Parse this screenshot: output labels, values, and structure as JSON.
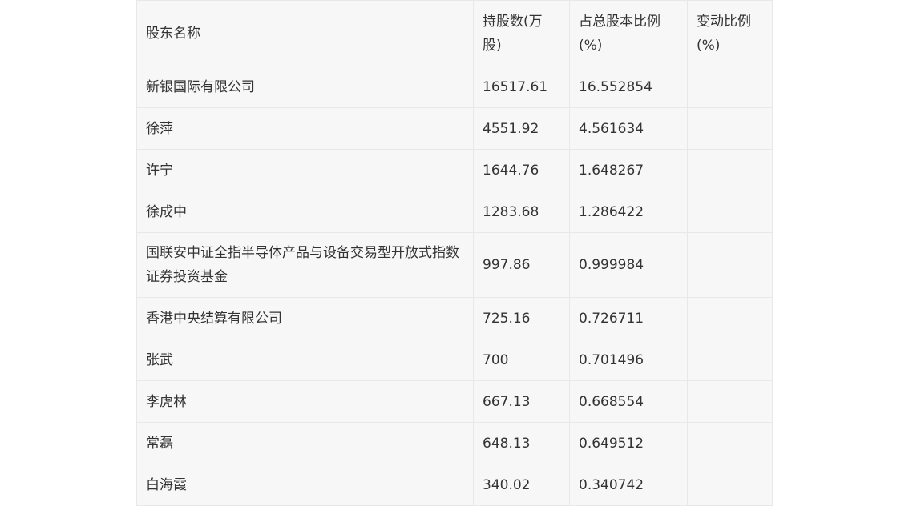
{
  "table": {
    "headers": [
      "股东名称",
      "持股数(万股)",
      "占总股本比例(%)",
      "变动比例(%)"
    ],
    "rows": [
      {
        "name": "新银国际有限公司",
        "shares": "16517.61",
        "ratio": "16.552854",
        "change": ""
      },
      {
        "name": "徐萍",
        "shares": "4551.92",
        "ratio": "4.561634",
        "change": ""
      },
      {
        "name": "许宁",
        "shares": "1644.76",
        "ratio": "1.648267",
        "change": ""
      },
      {
        "name": "徐成中",
        "shares": "1283.68",
        "ratio": "1.286422",
        "change": ""
      },
      {
        "name": "国联安中证全指半导体产品与设备交易型开放式指数证券投资基金",
        "shares": "997.86",
        "ratio": "0.999984",
        "change": ""
      },
      {
        "name": "香港中央结算有限公司",
        "shares": "725.16",
        "ratio": "0.726711",
        "change": ""
      },
      {
        "name": "张武",
        "shares": "700",
        "ratio": "0.701496",
        "change": ""
      },
      {
        "name": "李虎林",
        "shares": "667.13",
        "ratio": "0.668554",
        "change": ""
      },
      {
        "name": "常磊",
        "shares": "648.13",
        "ratio": "0.649512",
        "change": ""
      },
      {
        "name": "白海霞",
        "shares": "340.02",
        "ratio": "0.340742",
        "change": ""
      }
    ]
  }
}
